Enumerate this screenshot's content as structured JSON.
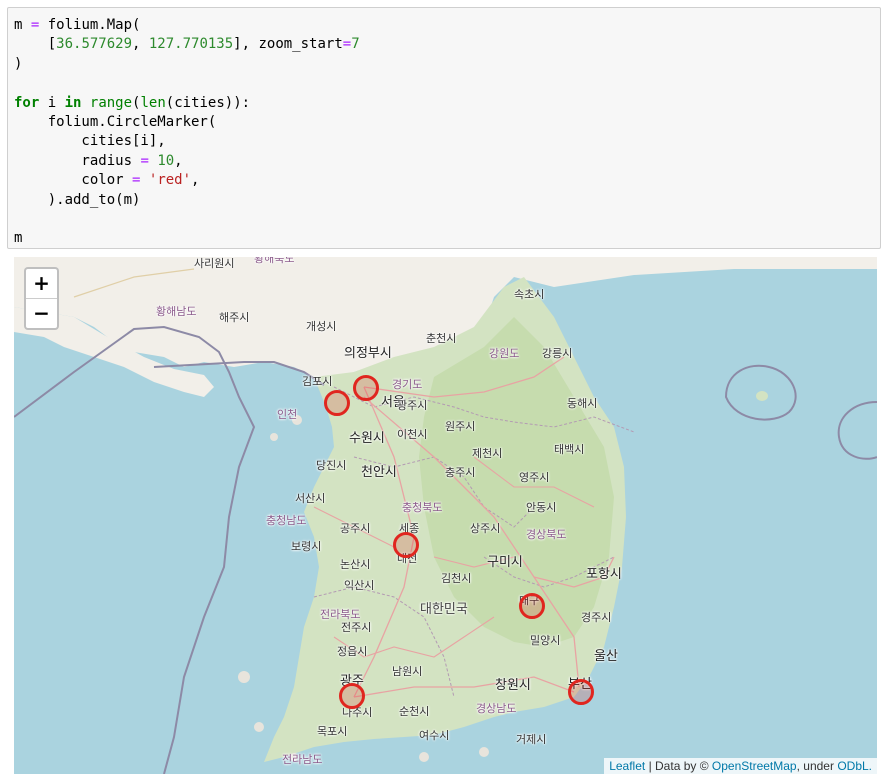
{
  "code": {
    "lines": [
      [
        [
          "",
          "m "
        ],
        [
          "op",
          "="
        ],
        [
          "",
          " folium.Map("
        ]
      ],
      [
        [
          "",
          "    ["
        ],
        [
          "nm",
          "36.577629"
        ],
        [
          "",
          ", "
        ],
        [
          "nm",
          "127.770135"
        ],
        [
          "",
          "], zoom_start"
        ],
        [
          "op",
          "="
        ],
        [
          "nm",
          "7"
        ]
      ],
      [
        [
          "",
          ")"
        ]
      ],
      [
        [
          "",
          ""
        ]
      ],
      [
        [
          "kw",
          "for"
        ],
        [
          "",
          " i "
        ],
        [
          "kw",
          "in"
        ],
        [
          "",
          " "
        ],
        [
          "bi",
          "range"
        ],
        [
          "",
          "("
        ],
        [
          "bi",
          "len"
        ],
        [
          "",
          "(cities)):"
        ]
      ],
      [
        [
          "",
          "    folium.CircleMarker("
        ]
      ],
      [
        [
          "",
          "        cities[i],"
        ]
      ],
      [
        [
          "",
          "        radius "
        ],
        [
          "op",
          "="
        ],
        [
          "",
          " "
        ],
        [
          "nm",
          "10"
        ],
        [
          "",
          ","
        ]
      ],
      [
        [
          "",
          "        color "
        ],
        [
          "op",
          "="
        ],
        [
          "",
          " "
        ],
        [
          "st",
          "'red'"
        ],
        [
          "",
          ","
        ]
      ],
      [
        [
          "",
          "    ).add_to(m)"
        ]
      ],
      [
        [
          "",
          ""
        ]
      ],
      [
        [
          "",
          "m"
        ]
      ]
    ]
  },
  "map": {
    "zoom_in_label": "+",
    "zoom_out_label": "−",
    "attribution": {
      "leaflet": "Leaflet",
      "sep": " | Data by © ",
      "osm": "OpenStreetMap",
      "under": ", under ",
      "odbl": "ODbL."
    },
    "marker_color": "#e0261f",
    "labels": [
      {
        "text": "사리원시",
        "cls": ""
      },
      {
        "text": "황해북도",
        "cls": "prov"
      },
      {
        "text": "황해남도",
        "cls": "prov"
      },
      {
        "text": "해주시",
        "cls": ""
      },
      {
        "text": "개성시",
        "cls": ""
      },
      {
        "text": "속초시",
        "cls": ""
      },
      {
        "text": "춘천시",
        "cls": ""
      },
      {
        "text": "의정부시",
        "cls": "big"
      },
      {
        "text": "강원도",
        "cls": "prov"
      },
      {
        "text": "강릉시",
        "cls": ""
      },
      {
        "text": "김포시",
        "cls": ""
      },
      {
        "text": "경기도",
        "cls": "prov"
      },
      {
        "text": "서울",
        "cls": "big"
      },
      {
        "text": "광주시",
        "cls": ""
      },
      {
        "text": "동해시",
        "cls": ""
      },
      {
        "text": "인천",
        "cls": "prov"
      },
      {
        "text": "원주시",
        "cls": ""
      },
      {
        "text": "수원시",
        "cls": "big"
      },
      {
        "text": "이천시",
        "cls": ""
      },
      {
        "text": "태백시",
        "cls": ""
      },
      {
        "text": "제천시",
        "cls": ""
      },
      {
        "text": "당진시",
        "cls": ""
      },
      {
        "text": "천안시",
        "cls": "big"
      },
      {
        "text": "충주시",
        "cls": ""
      },
      {
        "text": "영주시",
        "cls": ""
      },
      {
        "text": "서산시",
        "cls": ""
      },
      {
        "text": "충청북도",
        "cls": "prov"
      },
      {
        "text": "안동시",
        "cls": ""
      },
      {
        "text": "충청남도",
        "cls": "prov"
      },
      {
        "text": "공주시",
        "cls": ""
      },
      {
        "text": "세종",
        "cls": ""
      },
      {
        "text": "상주시",
        "cls": ""
      },
      {
        "text": "경상북도",
        "cls": "prov"
      },
      {
        "text": "보령시",
        "cls": ""
      },
      {
        "text": "대전",
        "cls": ""
      },
      {
        "text": "논산시",
        "cls": ""
      },
      {
        "text": "구미시",
        "cls": "big"
      },
      {
        "text": "포항시",
        "cls": "big"
      },
      {
        "text": "김천시",
        "cls": ""
      },
      {
        "text": "익산시",
        "cls": ""
      },
      {
        "text": "대구",
        "cls": ""
      },
      {
        "text": "전라북도",
        "cls": "prov"
      },
      {
        "text": "대한민국",
        "cls": "country"
      },
      {
        "text": "경주시",
        "cls": ""
      },
      {
        "text": "전주시",
        "cls": ""
      },
      {
        "text": "밀양시",
        "cls": ""
      },
      {
        "text": "울산",
        "cls": "big"
      },
      {
        "text": "정읍시",
        "cls": ""
      },
      {
        "text": "남원시",
        "cls": ""
      },
      {
        "text": "광주",
        "cls": "big"
      },
      {
        "text": "창원시",
        "cls": "big"
      },
      {
        "text": "부산",
        "cls": "big"
      },
      {
        "text": "나주시",
        "cls": ""
      },
      {
        "text": "순천시",
        "cls": ""
      },
      {
        "text": "경상남도",
        "cls": "prov"
      },
      {
        "text": "목포시",
        "cls": ""
      },
      {
        "text": "여수시",
        "cls": ""
      },
      {
        "text": "거제시",
        "cls": ""
      },
      {
        "text": "전라남도",
        "cls": "prov"
      }
    ]
  }
}
